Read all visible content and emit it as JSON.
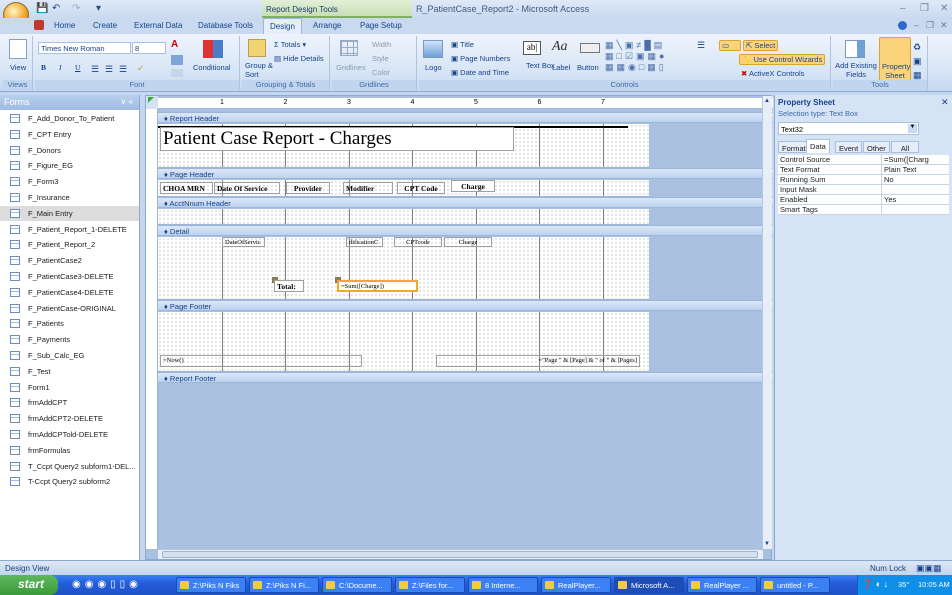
{
  "window": {
    "title": "R_PatientCase_Report2 - Microsoft Access",
    "context_tools": "Report Design Tools"
  },
  "tabs": [
    "Home",
    "Create",
    "External Data",
    "Database Tools",
    "Design",
    "Arrange",
    "Page Setup"
  ],
  "active_tab": "Design",
  "ribbon": {
    "views": {
      "label": "Views",
      "view": "View"
    },
    "font": {
      "label": "Font",
      "font_name": "Times New Roman",
      "font_size": "8",
      "bold": "B",
      "italic": "I",
      "underline": "U",
      "conditional": "Conditional"
    },
    "grouping": {
      "label": "Grouping & Totals",
      "group_sort": "Group & Sort",
      "totals": "Totals",
      "hide_details": "Hide Details"
    },
    "gridlines": {
      "label": "Gridlines",
      "gridlines": "Gridlines",
      "width": "Width",
      "style": "Style",
      "color": "Color"
    },
    "controls": {
      "label": "Controls",
      "logo": "Logo",
      "title": "Title",
      "page_numbers": "Page Numbers",
      "date_time": "Date and Time",
      "text_box": "Text Box",
      "label_btn": "Label",
      "button": "Button",
      "select": "Select",
      "wizards": "Use Control Wizards",
      "activex": "ActiveX Controls"
    },
    "tools": {
      "label": "Tools",
      "add_fields": "Add Existing Fields",
      "property_sheet": "Property Sheet"
    }
  },
  "nav": {
    "header": "Forms",
    "items": [
      "F_Add_Donor_To_Patient",
      "F_CPT Entry",
      "F_Donors",
      "F_Figure_EG",
      "F_Form3",
      "F_Insurance",
      "F_Main Entry",
      "F_Patient_Report_1-DELETE",
      "F_Patient_Report_2",
      "F_PatientCase2",
      "F_PatientCase3-DELETE",
      "F_PatientCase4-DELETE",
      "F_PatientCase-ORIGINAL",
      "F_Patients",
      "F_Payments",
      "F_Sub_Calc_EG",
      "F_Test",
      "Form1",
      "frmAddCPT",
      "frmAddCPT2-DELETE",
      "frmAddCPTold-DELETE",
      "frmFormulas",
      "T_Ccpt Query2 subform1-DEL...",
      "T-Ccpt Query2 subform2"
    ],
    "selected": "F_Main Entry"
  },
  "report": {
    "sections": [
      "Report Header",
      "Page Header",
      "AcctNnum Header",
      "Detail",
      "Page Footer",
      "Report Footer"
    ],
    "title": "Patient Case Report  - Charges",
    "page_header_labels": [
      "CHOA MRN",
      "Date Of Service",
      "Provider",
      "Modifier",
      "CPT Code",
      "Charge"
    ],
    "detail_fields": [
      "DateOfServic",
      "dificationC",
      "CPTcode",
      "Charge"
    ],
    "total_label": "Total:",
    "total_field": "=Sum([Charge])",
    "footer_now": "=Now()",
    "footer_page": "=\"Page \" & [Page] & \" of \" & [Pages]",
    "ruler": [
      "1",
      "2",
      "3",
      "4",
      "5",
      "6",
      "7"
    ]
  },
  "property_sheet": {
    "title": "Property Sheet",
    "selection_type": "Selection type:  Text Box",
    "object": "Text32",
    "tabs": [
      "Format",
      "Data",
      "Event",
      "Other",
      "All"
    ],
    "active_tab": "Data",
    "rows": [
      {
        "k": "Control Source",
        "v": "=Sum([Charg"
      },
      {
        "k": "Text Format",
        "v": "Plain Text"
      },
      {
        "k": "Running Sum",
        "v": "No"
      },
      {
        "k": "Input Mask",
        "v": ""
      },
      {
        "k": "Enabled",
        "v": "Yes"
      },
      {
        "k": "Smart Tags",
        "v": ""
      }
    ]
  },
  "status": {
    "left": "Design View",
    "right": "Num Lock"
  },
  "taskbar": {
    "start": "start",
    "tasks": [
      "Z:\\Piks N Fiks",
      "Z:\\Piks N Fi...",
      "C:\\Docume...",
      "Z:\\Files for...",
      "8 Interne...",
      "RealPlayer...",
      "Microsoft A...",
      "RealPlayer ...",
      "untitled - P..."
    ],
    "active_task": "Microsoft A...",
    "clock": "10:05 AM",
    "temp": "35°"
  }
}
